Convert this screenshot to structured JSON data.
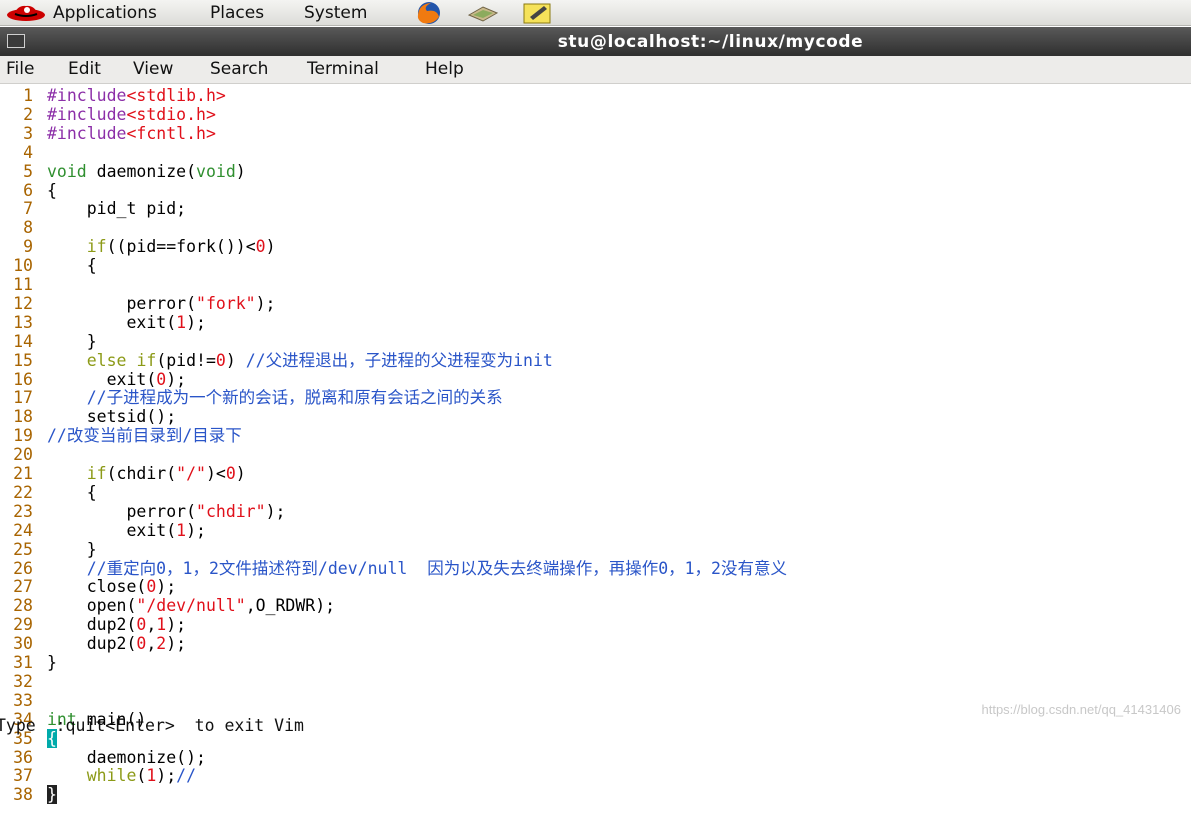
{
  "panel": {
    "menus": [
      "Applications",
      "Places",
      "System"
    ],
    "launchers": [
      "firefox-icon",
      "network-icon",
      "notes-icon"
    ]
  },
  "window": {
    "title": "stu@localhost:~/linux/mycode"
  },
  "menubar": {
    "items": [
      "File",
      "Edit",
      "View",
      "Search",
      "Terminal",
      "Help"
    ]
  },
  "editor": {
    "lines": [
      {
        "n": "1",
        "t": "#include<stdlib.h>"
      },
      {
        "n": "2",
        "t": "#include<stdio.h>"
      },
      {
        "n": "3",
        "t": "#include<fcntl.h>"
      },
      {
        "n": "4",
        "t": ""
      },
      {
        "n": "5",
        "t": "void daemonize(void)"
      },
      {
        "n": "6",
        "t": "{"
      },
      {
        "n": "7",
        "t": "    pid_t pid;"
      },
      {
        "n": "8",
        "t": ""
      },
      {
        "n": "9",
        "t": "    if((pid==fork())<0)"
      },
      {
        "n": "10",
        "t": "    {"
      },
      {
        "n": "11",
        "t": ""
      },
      {
        "n": "12",
        "t": "        perror(\"fork\");"
      },
      {
        "n": "13",
        "t": "        exit(1);"
      },
      {
        "n": "14",
        "t": "    }"
      },
      {
        "n": "15",
        "t": "    else if(pid!=0) //父进程退出，子进程的父进程变为init"
      },
      {
        "n": "16",
        "t": "      exit(0);"
      },
      {
        "n": "17",
        "t": "    //子进程成为一个新的会话，脱离和原有会话之间的关系"
      },
      {
        "n": "18",
        "t": "    setsid();"
      },
      {
        "n": "19",
        "t": "//改变当前目录到/目录下"
      },
      {
        "n": "20",
        "t": ""
      },
      {
        "n": "21",
        "t": "    if(chdir(\"/\")<0)"
      },
      {
        "n": "22",
        "t": "    {"
      },
      {
        "n": "23",
        "t": "        perror(\"chdir\");"
      },
      {
        "n": "24",
        "t": "        exit(1);"
      },
      {
        "n": "25",
        "t": "    }"
      },
      {
        "n": "26",
        "t": "    //重定向0，1，2文件描述符到/dev/null  因为以及失去终端操作，再操作0，1，2没有意义"
      },
      {
        "n": "27",
        "t": "    close(0);"
      },
      {
        "n": "28",
        "t": "    open(\"/dev/null\",O_RDWR);"
      },
      {
        "n": "29",
        "t": "    dup2(0,1);"
      },
      {
        "n": "30",
        "t": "    dup2(0,2);"
      },
      {
        "n": "31",
        "t": "}"
      },
      {
        "n": "32",
        "t": ""
      },
      {
        "n": "33",
        "t": ""
      },
      {
        "n": "34",
        "t": "int main()"
      },
      {
        "n": "35",
        "t": "{"
      },
      {
        "n": "36",
        "t": "    daemonize();"
      },
      {
        "n": "37",
        "t": "    while(1);//"
      },
      {
        "n": "38",
        "t": "}"
      }
    ],
    "status": "Type  :quit<Enter>  to exit Vim"
  },
  "watermark": "https://blog.csdn.net/qq_41431406"
}
